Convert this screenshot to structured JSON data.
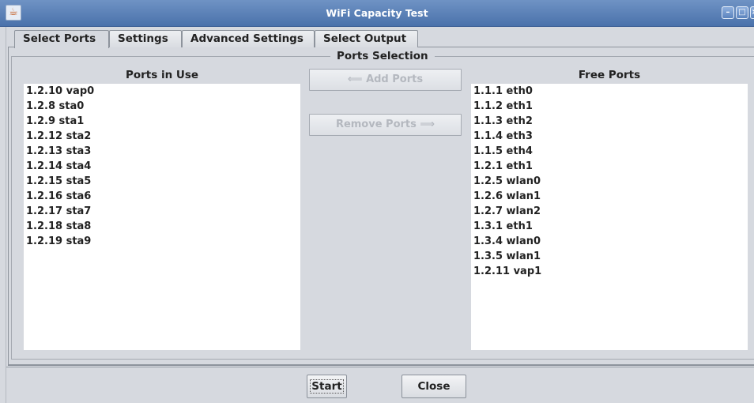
{
  "window": {
    "title": "WiFi Capacity Test",
    "icon": "java-cup-icon",
    "controls": [
      "minimize",
      "maximize",
      "close"
    ]
  },
  "tabs": [
    {
      "label": "Select Ports",
      "active": true
    },
    {
      "label": "Settings",
      "active": false
    },
    {
      "label": "Advanced Settings",
      "active": false
    },
    {
      "label": "Select Output",
      "active": false
    }
  ],
  "ports_selection": {
    "title": "Ports Selection",
    "in_use_header": "Ports in Use",
    "free_header": "Free Ports",
    "add_button": "⟸ Add Ports",
    "remove_button": "Remove Ports ⟹",
    "ports_in_use": [
      "1.2.10 vap0",
      "1.2.8 sta0",
      "1.2.9 sta1",
      "1.2.12 sta2",
      "1.2.13 sta3",
      "1.2.14 sta4",
      "1.2.15 sta5",
      "1.2.16 sta6",
      "1.2.17 sta7",
      "1.2.18 sta8",
      "1.2.19 sta9"
    ],
    "free_ports": [
      "1.1.1 eth0",
      "1.1.2 eth1",
      "1.1.3 eth2",
      "1.1.4 eth3",
      "1.1.5 eth4",
      "1.2.1 eth1",
      "1.2.5 wlan0",
      "1.2.6 wlan1",
      "1.2.7 wlan2",
      "1.3.1 eth1",
      "1.3.4 wlan0",
      "1.3.5 wlan1",
      "1.2.11 vap1"
    ]
  },
  "footer": {
    "start_label": "Start",
    "close_label": "Close"
  }
}
